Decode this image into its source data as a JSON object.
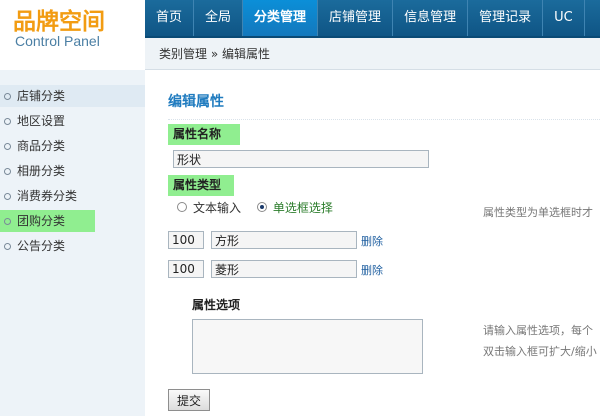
{
  "logo": {
    "title": "品牌空间",
    "subtitle": "Control Panel"
  },
  "nav": [
    "首页",
    "全局",
    "分类管理",
    "店铺管理",
    "信息管理",
    "管理记录",
    "UC"
  ],
  "breadcrumb": "类别管理 » 编辑属性",
  "sidebar": {
    "items": [
      {
        "label": "店铺分类"
      },
      {
        "label": "地区设置"
      },
      {
        "label": "商品分类"
      },
      {
        "label": "相册分类"
      },
      {
        "label": "消费券分类"
      },
      {
        "label": "团购分类"
      },
      {
        "label": "公告分类"
      }
    ]
  },
  "form": {
    "title": "编辑属性",
    "name_label": "属性名称",
    "name_value": "形状",
    "type_label": "属性类型",
    "type_options": [
      "文本输入",
      "单选框选择"
    ],
    "type_hint": "属性类型为单选框时才",
    "rows": [
      {
        "order": "100",
        "value": "方形",
        "delete": "删除"
      },
      {
        "order": "100",
        "value": "菱形",
        "delete": "删除"
      }
    ],
    "options_label": "属性选项",
    "options_hint_1": "请输入属性选项，每个",
    "options_hint_2": "双击输入框可扩大/缩小",
    "submit": "提交"
  },
  "colors": {
    "header": "#0f5585",
    "active_tab": "#0b8fd8",
    "highlight": "#90ee90",
    "logo": "#f29c12"
  }
}
